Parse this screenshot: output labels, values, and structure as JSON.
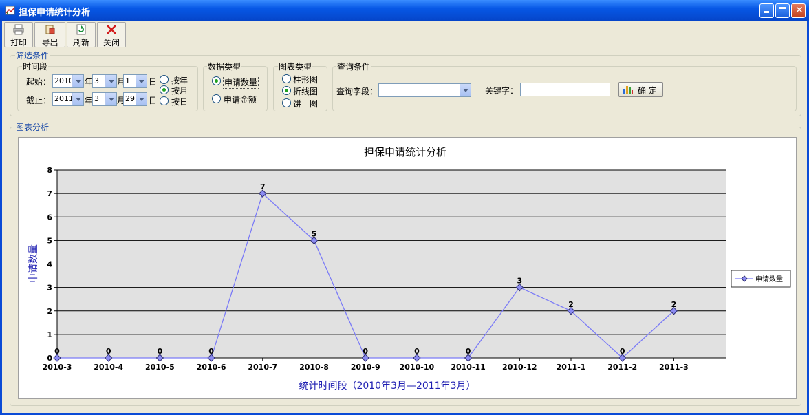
{
  "window": {
    "title": "担保申请统计分析"
  },
  "toolbar": [
    {
      "label": "打印",
      "icon": "printer-icon"
    },
    {
      "label": "导出",
      "icon": "export-icon"
    },
    {
      "label": "刷新",
      "icon": "refresh-icon"
    },
    {
      "label": "关闭",
      "icon": "close-icon"
    }
  ],
  "filter": {
    "group_title": "筛选条件",
    "period": {
      "title": "时间段",
      "start_label": "起始：",
      "end_label": "截止：",
      "start": {
        "year": "2010",
        "month": "3",
        "day": "1"
      },
      "end": {
        "year": "2011",
        "month": "3",
        "day": "29"
      },
      "year_suffix": "年",
      "month_suffix": "月",
      "day_suffix": "日",
      "options": [
        "按年",
        "按月",
        "按日"
      ],
      "selected": "按月"
    },
    "data_type": {
      "title": "数据类型",
      "options": [
        "申请数量",
        "申请金额"
      ],
      "selected": "申请数量"
    },
    "chart_type": {
      "title": "图表类型",
      "options": [
        "柱形图",
        "折线图",
        "饼　图"
      ],
      "selected": "折线图"
    },
    "query": {
      "title": "查询条件",
      "field_label": "查询字段：",
      "field_value": "",
      "keyword_label": "关键字：",
      "keyword_value": "",
      "confirm_label": "确 定"
    }
  },
  "chart_section": {
    "title": "图表分析"
  },
  "colors": {
    "line": "#7b7bf7",
    "plot_bg": "#e1e1e1",
    "axis_title": "#1f1fb2"
  },
  "chart_data": {
    "type": "line",
    "title": "担保申请统计分析",
    "xlabel": "统计时间段（2010年3月—2011年3月）",
    "ylabel": "申请数量",
    "categories": [
      "2010-3",
      "2010-4",
      "2010-5",
      "2010-6",
      "2010-7",
      "2010-8",
      "2010-9",
      "2010-10",
      "2010-11",
      "2010-12",
      "2011-1",
      "2011-2",
      "2011-3"
    ],
    "series": [
      {
        "name": "申请数量",
        "values": [
          0,
          0,
          0,
          0,
          7,
          5,
          0,
          0,
          0,
          3,
          2,
          0,
          2
        ]
      }
    ],
    "ylim": [
      0,
      8
    ],
    "yticks": [
      0,
      1,
      2,
      3,
      4,
      5,
      6,
      7,
      8
    ],
    "grid": true,
    "legend": "right",
    "data_labels": true
  }
}
